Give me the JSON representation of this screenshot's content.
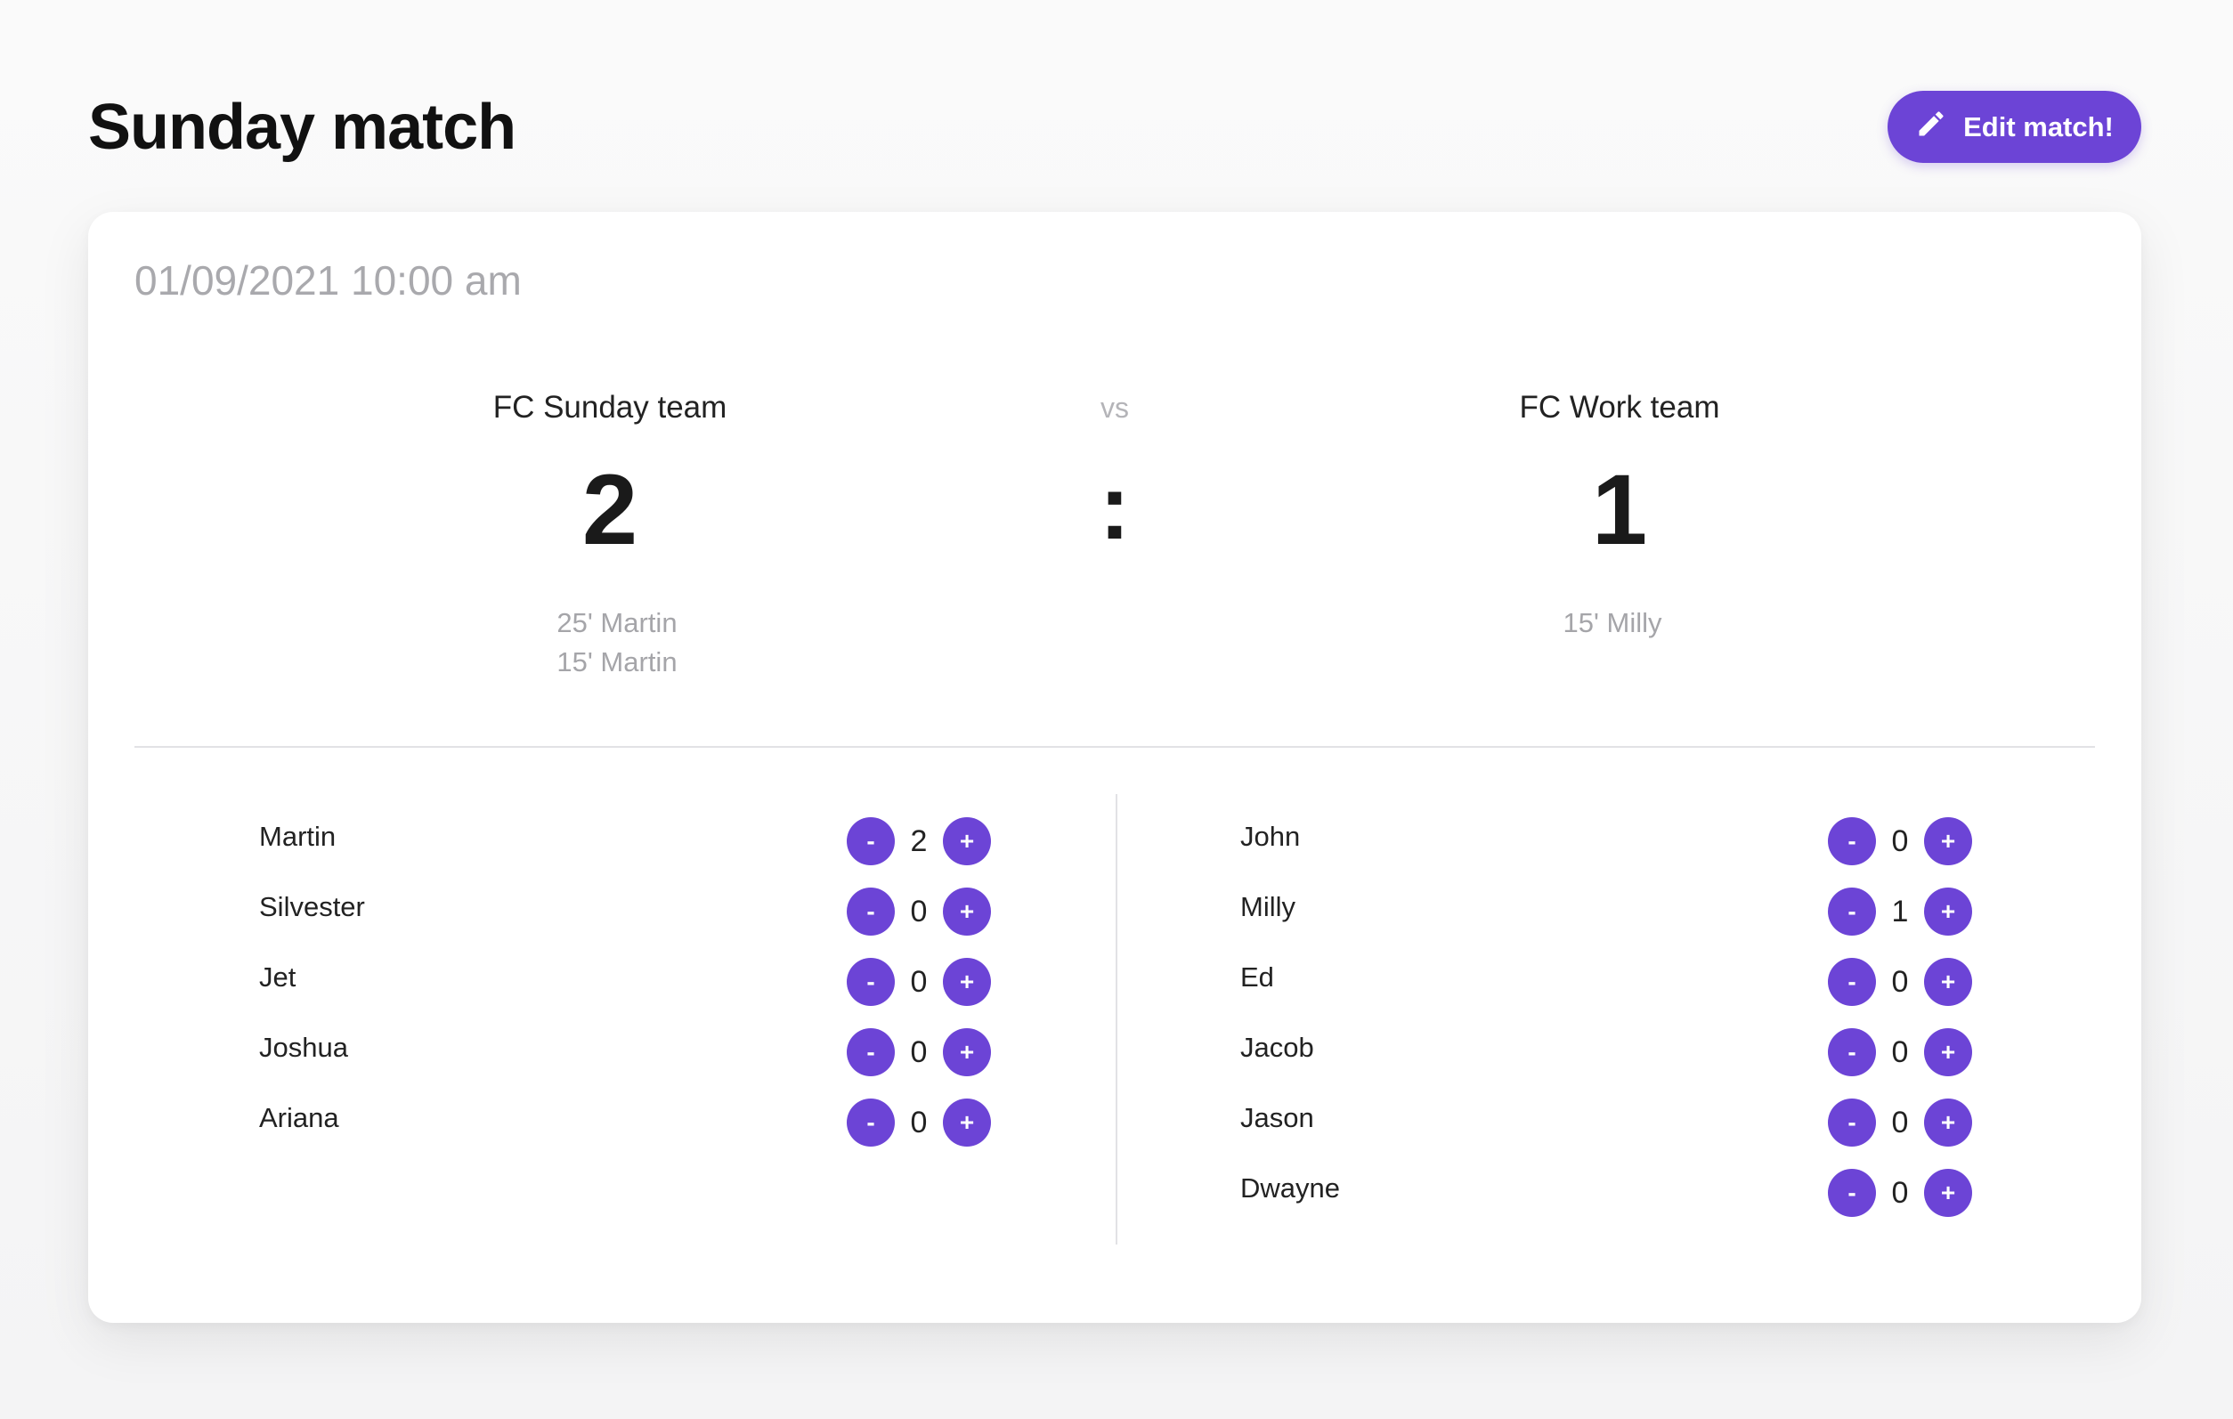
{
  "header": {
    "title": "Sunday match",
    "edit_button_label": "Edit match!"
  },
  "match": {
    "datetime": "01/09/2021 10:00 am",
    "vs_label": "vs",
    "score_separator": ":",
    "home": {
      "name": "FC Sunday team",
      "score": "2",
      "goals": [
        "25' Martin",
        "15' Martin"
      ],
      "players": [
        {
          "name": "Martin",
          "goals": "2"
        },
        {
          "name": "Silvester",
          "goals": "0"
        },
        {
          "name": "Jet",
          "goals": "0"
        },
        {
          "name": "Joshua",
          "goals": "0"
        },
        {
          "name": "Ariana",
          "goals": "0"
        }
      ]
    },
    "away": {
      "name": "FC Work team",
      "score": "1",
      "goals": [
        "15' Milly"
      ],
      "players": [
        {
          "name": "John",
          "goals": "0"
        },
        {
          "name": "Milly",
          "goals": "1"
        },
        {
          "name": "Ed",
          "goals": "0"
        },
        {
          "name": "Jacob",
          "goals": "0"
        },
        {
          "name": "Jason",
          "goals": "0"
        },
        {
          "name": "Dwayne",
          "goals": "0"
        }
      ]
    }
  },
  "controls": {
    "decrement_label": "-",
    "increment_label": "+"
  },
  "icons": {
    "edit": "pencil-icon"
  },
  "colors": {
    "accent": "#6c44d6",
    "muted_text": "#a9a9ad"
  }
}
